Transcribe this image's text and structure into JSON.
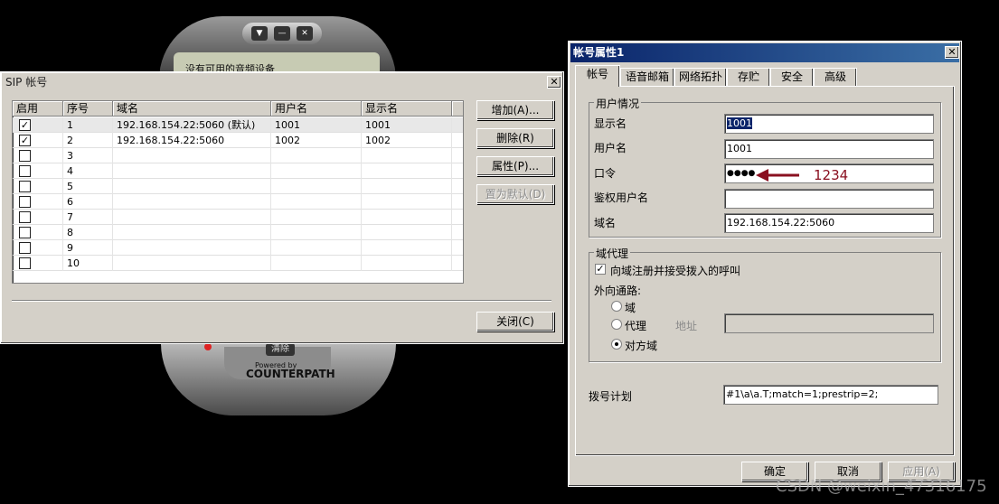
{
  "phone": {
    "status_text": "没有可用的音频设备",
    "clear_label": "清除",
    "powered_by": "Powered by",
    "brand": "COUNTERPATH"
  },
  "sip_window": {
    "title": "SIP 帐号",
    "columns": [
      "启用",
      "序号",
      "域名",
      "用户名",
      "显示名"
    ],
    "rows": [
      {
        "enabled": true,
        "index": "1",
        "domain": "192.168.154.22:5060 (默认)",
        "user": "1001",
        "display": "1001"
      },
      {
        "enabled": true,
        "index": "2",
        "domain": "192.168.154.22:5060",
        "user": "1002",
        "display": "1002"
      },
      {
        "enabled": false,
        "index": "3",
        "domain": "",
        "user": "",
        "display": ""
      },
      {
        "enabled": false,
        "index": "4",
        "domain": "",
        "user": "",
        "display": ""
      },
      {
        "enabled": false,
        "index": "5",
        "domain": "",
        "user": "",
        "display": ""
      },
      {
        "enabled": false,
        "index": "6",
        "domain": "",
        "user": "",
        "display": ""
      },
      {
        "enabled": false,
        "index": "7",
        "domain": "",
        "user": "",
        "display": ""
      },
      {
        "enabled": false,
        "index": "8",
        "domain": "",
        "user": "",
        "display": ""
      },
      {
        "enabled": false,
        "index": "9",
        "domain": "",
        "user": "",
        "display": ""
      },
      {
        "enabled": false,
        "index": "10",
        "domain": "",
        "user": "",
        "display": ""
      }
    ],
    "buttons": {
      "add": "增加(A)...",
      "delete": "删除(R)",
      "properties": "属性(P)...",
      "set_default": "置为默认(D)",
      "close": "关闭(C)"
    }
  },
  "acct_window": {
    "title": "帐号属性1",
    "tabs": [
      "帐号",
      "语音邮箱",
      "网络拓扑",
      "存贮",
      "安全",
      "高级"
    ],
    "user_group": {
      "title": "用户情况",
      "display_name_label": "显示名",
      "display_name_value": "1001",
      "username_label": "用户名",
      "username_value": "1001",
      "password_label": "口令",
      "password_value": "●●●●",
      "password_note": "1234",
      "auth_user_label": "鉴权用户名",
      "auth_user_value": "",
      "domain_label": "域名",
      "domain_value": "192.168.154.22:5060"
    },
    "proxy_group": {
      "title": "域代理",
      "register_label": "向域注册并接受拨入的呼叫",
      "register_checked": true,
      "outbound_label": "外向通路:",
      "opt_domain": "域",
      "opt_proxy": "代理",
      "address_label": "地址",
      "opt_target_domain": "对方域",
      "selected": "对方域"
    },
    "dial_plan_label": "拨号计划",
    "dial_plan_value": "#1\\a\\a.T;match=1;prestrip=2;",
    "buttons": {
      "ok": "确定",
      "cancel": "取消",
      "apply": "应用(A)"
    }
  },
  "watermark": "CSDN @weixin_47316175",
  "colors": {
    "title_active": "#0a246a",
    "dialog_bg": "#d4d0c8",
    "annotation": "#8a1020"
  }
}
